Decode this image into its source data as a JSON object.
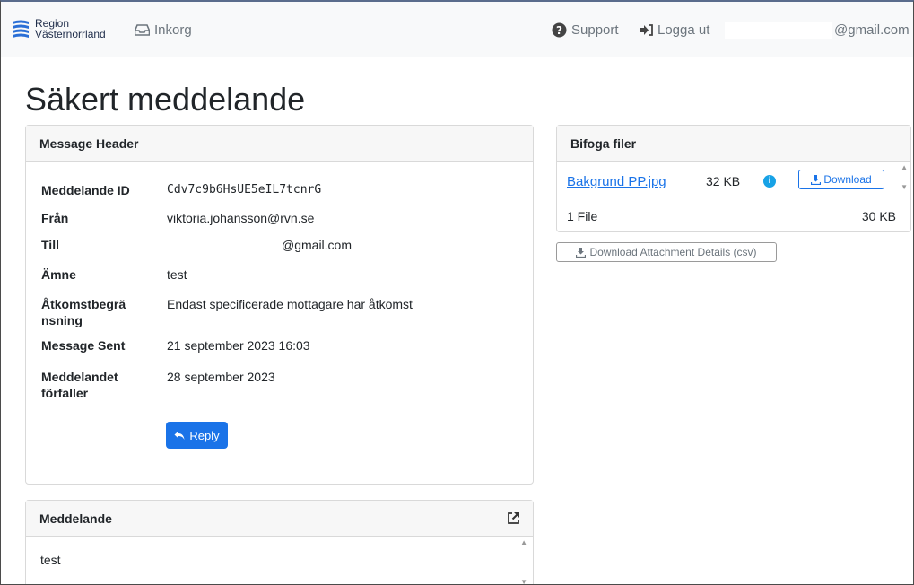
{
  "navbar": {
    "brand_line1": "Region",
    "brand_line2": "Västernorrland",
    "inbox_label": "Inkorg",
    "support_label": "Support",
    "logout_label": "Logga ut",
    "email_suffix": "@gmail.com"
  },
  "page_title": "Säkert meddelande",
  "message_header": {
    "title": "Message Header",
    "rows": [
      {
        "key": "Meddelande ID",
        "value": "Cdv7c9b6HsUE5eIL7tcnrG"
      },
      {
        "key": "Från",
        "value": "viktoria.johansson@rvn.se"
      },
      {
        "key": "Till",
        "value": "@gmail.com"
      },
      {
        "key": "Ämne",
        "value": "test"
      },
      {
        "key": "Åtkomstbegrä nsning",
        "value": "Endast specificerade mottagare har åtkomst"
      },
      {
        "key": "Message Sent",
        "value": "21 september 2023 16:03"
      },
      {
        "key": "Meddelandet förfaller",
        "value": "28 september 2023"
      }
    ],
    "reply_label": "Reply"
  },
  "message": {
    "title": "Meddelande",
    "body": "test"
  },
  "files": {
    "title": "Bifoga filer",
    "items": [
      {
        "name": "Bakgrund PP.jpg",
        "size": "32 KB",
        "download_label": "Download"
      }
    ],
    "total_count": "1 File",
    "total_size": "30 KB",
    "csv_label": "Download Attachment Details (csv)"
  },
  "colors": {
    "link": "#1a73e8",
    "primary_button": "#1a73e8",
    "info": "#17a2e6"
  }
}
